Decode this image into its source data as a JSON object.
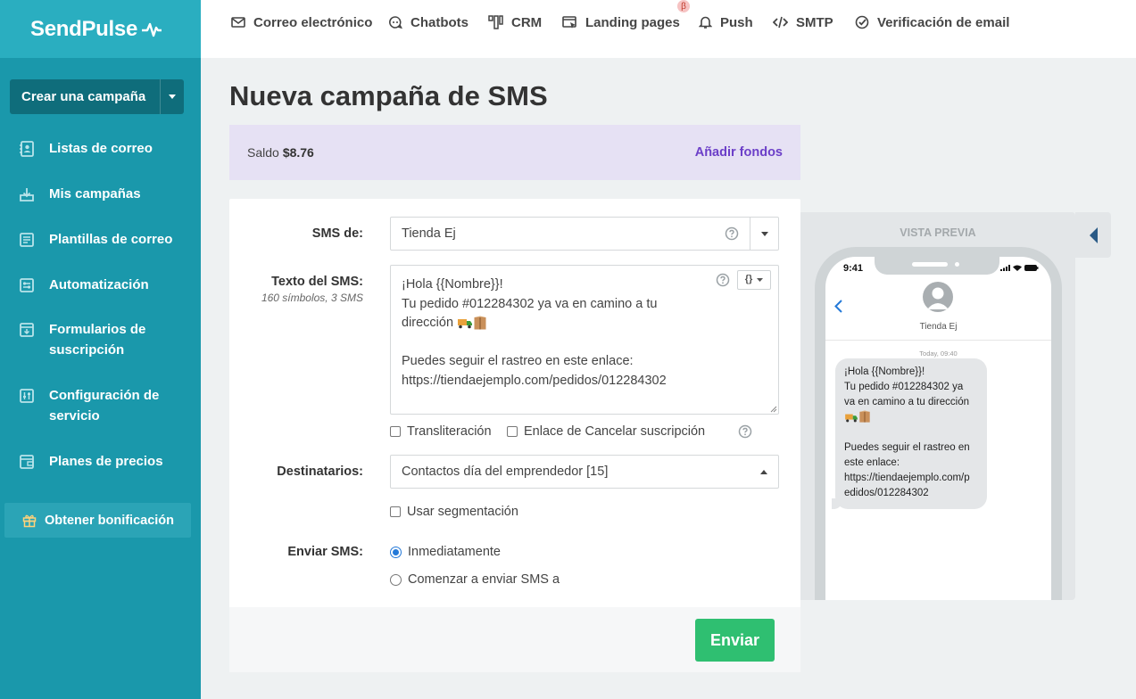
{
  "sidebar": {
    "logo": "SendPulse",
    "create_button": "Crear una campaña",
    "items": [
      {
        "label": "Listas de correo",
        "icon": "address-book-icon"
      },
      {
        "label": "Mis campañas",
        "icon": "campaigns-icon"
      },
      {
        "label": "Plantillas de correo",
        "icon": "templates-icon"
      },
      {
        "label": "Automatización",
        "icon": "automation-icon"
      },
      {
        "label": "Formularios de suscripción",
        "icon": "forms-icon"
      },
      {
        "label": "Configuración de servicio",
        "icon": "settings-sliders-icon"
      },
      {
        "label": "Planes de precios",
        "icon": "wallet-icon"
      }
    ],
    "bonus": "Obtener bonificación"
  },
  "topnav": {
    "items": [
      {
        "label": "Correo electrónico",
        "icon": "mail-icon"
      },
      {
        "label": "Chatbots",
        "icon": "chatbot-icon"
      },
      {
        "label": "CRM",
        "icon": "crm-icon"
      },
      {
        "label": "Landing pages",
        "icon": "landing-icon"
      },
      {
        "label": "Push",
        "icon": "bell-icon"
      },
      {
        "label": "SMTP",
        "icon": "code-icon"
      },
      {
        "label": "Verificación de email",
        "icon": "check-circle-icon"
      }
    ],
    "beta_badge": "β"
  },
  "page": {
    "title": "Nueva campaña de SMS"
  },
  "balance": {
    "label": "Saldo",
    "amount": "$8.76",
    "add_funds": "Añadir fondos"
  },
  "form": {
    "sender_label": "SMS de:",
    "sender_value": "Tienda Ej",
    "text_label": "Texto del SMS:",
    "text_sub": "160 símbolos, 3 SMS",
    "message_lines": [
      "¡Hola {{Nombre}}!",
      "Tu pedido #012284302 ya va en camino a tu",
      "dirección",
      "",
      "Puedes seguir el rastreo en este enlace:",
      "https://tiendaejemplo.com/pedidos/012284302"
    ],
    "vars_button": "{}",
    "transliteration": "Transliteración",
    "unsubscribe_link": "Enlace de Cancelar suscripción",
    "recipients_label": "Destinatarios:",
    "recipients_value": "Contactos día del emprendedor [15]",
    "segmentation": "Usar segmentación",
    "send_label": "Enviar SMS:",
    "send_now": "Inmediatamente",
    "send_later": "Comenzar a enviar SMS a",
    "send_button": "Enviar"
  },
  "preview": {
    "title": "VISTA PREVIA",
    "time": "9:41",
    "contact": "Tienda Ej",
    "date": "Today, 09:40",
    "bubble_lines": [
      "¡Hola {{Nombre}}!",
      "Tu pedido #012284302 ya",
      "va en camino a tu dirección",
      "",
      "",
      "Puedes seguir el rastreo en",
      "este enlace:",
      "https://tiendaejemplo.com/p",
      "edidos/012284302"
    ]
  },
  "colors": {
    "sidebar": "#1a98ab",
    "accent_purple": "#6c3fc8",
    "send_green": "#2fbf71"
  }
}
